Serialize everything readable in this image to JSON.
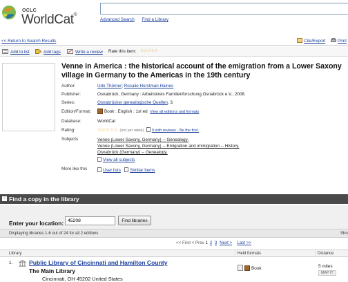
{
  "header": {
    "logo_small": "OCLC",
    "logo_main": "WorldCat",
    "logo_reg": "®",
    "search_value": "",
    "advanced_search": "Advanced Search",
    "find_library": "Find a Library"
  },
  "toolbar": {
    "return_link": "<< Return to Search Results",
    "cite_export": "Cite/Export",
    "print": "Print"
  },
  "actions": {
    "add_to_list": "Add to list",
    "add_tags": "Add tags",
    "write_review": "Write a review",
    "rate_label": "Rate this item:",
    "rate_stars": "☆☆☆☆☆"
  },
  "record": {
    "title_line1": "Venne in America : the historical account of the emigration from a Lower Saxony",
    "title_line2": "village in Germany to the Americas in the 19th century",
    "labels": {
      "author": "Author:",
      "publisher": "Publisher:",
      "series": "Series:",
      "edition": "Edition/Format:",
      "database": "Database:",
      "rating": "Rating:",
      "subjects": "Subjects",
      "more_like": "More like this"
    },
    "author_1": "Udo Thörner",
    "author_sep": "; ",
    "author_2": "Rosalie Horstman Haines",
    "publisher": "Osnabrück, Germany : Arbeitskreis Familienforschung Osnabrück e.V., 2008.",
    "series_link": "Osnabrücker genealogische Quellen",
    "series_suffix": ", 3.",
    "edition": "Book : English : 1st ed",
    "edition_link": "View all editions and formats",
    "database": "WorldCat",
    "rating_stars": "☆☆☆☆☆",
    "rating_note": "(not yet rated)",
    "reviews_count": "0",
    "reviews_link": " with reviews - Be the first.",
    "subjects": [
      "Venne (Lower Saxony, Germany) -- Genealogy.",
      "Venne (Lower Saxony, Germany) -- Emigration and immigration -- History.",
      "Osnabrück (Germany) -- Genealogy."
    ],
    "view_all_subjects": "View all subjects",
    "user_lists": "User lists",
    "similar_items": "Similar Items"
  },
  "find_copy": {
    "header": "Find a copy in the library",
    "toggle": "–",
    "location_label": "Enter your location:",
    "location_value": "45208",
    "find_button": "Find libraries",
    "displaying": "Displaying libraries 1-6 out of 24 for all 2 editions",
    "show_cut": "Sho",
    "pager": {
      "first": "<< First",
      "prev": "< Prev",
      "p1": "1",
      "p2": "2",
      "p3": "3",
      "next": "Next >",
      "last": "Last >>"
    },
    "columns": {
      "library": "Library",
      "held": "Held formats",
      "distance": "Distance"
    },
    "rows": [
      {
        "num": "1.",
        "name": "Public Library of Cincinnati and Hamilton County",
        "branch": "The Main Library",
        "address": "Cincinnati, OH 45202 United States",
        "held": "Book",
        "distance": "5 miles",
        "map": "MAP IT"
      }
    ]
  },
  "colors": {
    "link": "#1a3f9c",
    "bar_dark": "#4a4a4a",
    "logo_green": "#4f9a3a",
    "logo_orange": "#e58b24"
  }
}
